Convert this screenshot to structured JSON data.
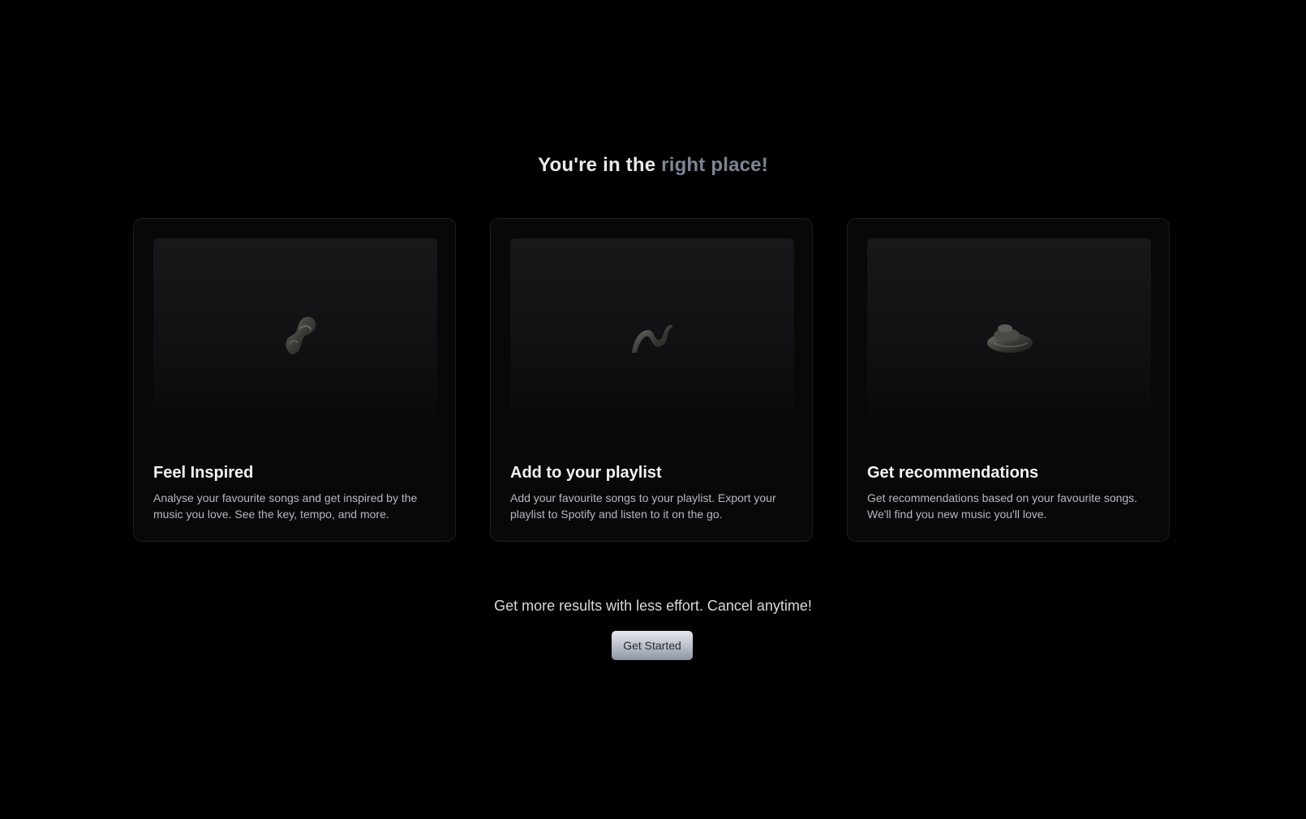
{
  "headline": {
    "part1": "You're in the ",
    "part2": "right place!"
  },
  "cards": [
    {
      "title": "Feel Inspired",
      "description": "Analyse your favourite songs and get inspired by the music you love. See the key, tempo, and more.",
      "icon": "abstract-knot-shape-icon"
    },
    {
      "title": "Add to your playlist",
      "description": "Add your favourite songs to your playlist. Export your playlist to Spotify and listen to it on the go.",
      "icon": "abstract-wave-shape-icon"
    },
    {
      "title": "Get recommendations",
      "description": "Get recommendations based on your favourite songs. We'll find you new music you'll love.",
      "icon": "abstract-swirl-shape-icon"
    }
  ],
  "tagline": "Get more results with less effort. Cancel anytime!",
  "cta": {
    "label": "Get Started"
  },
  "colors": {
    "background": "#000000",
    "headline_primary": "#e9eaee",
    "headline_accent": "#7f8593",
    "card_background": "#080809",
    "card_border": "#1d1e21"
  }
}
